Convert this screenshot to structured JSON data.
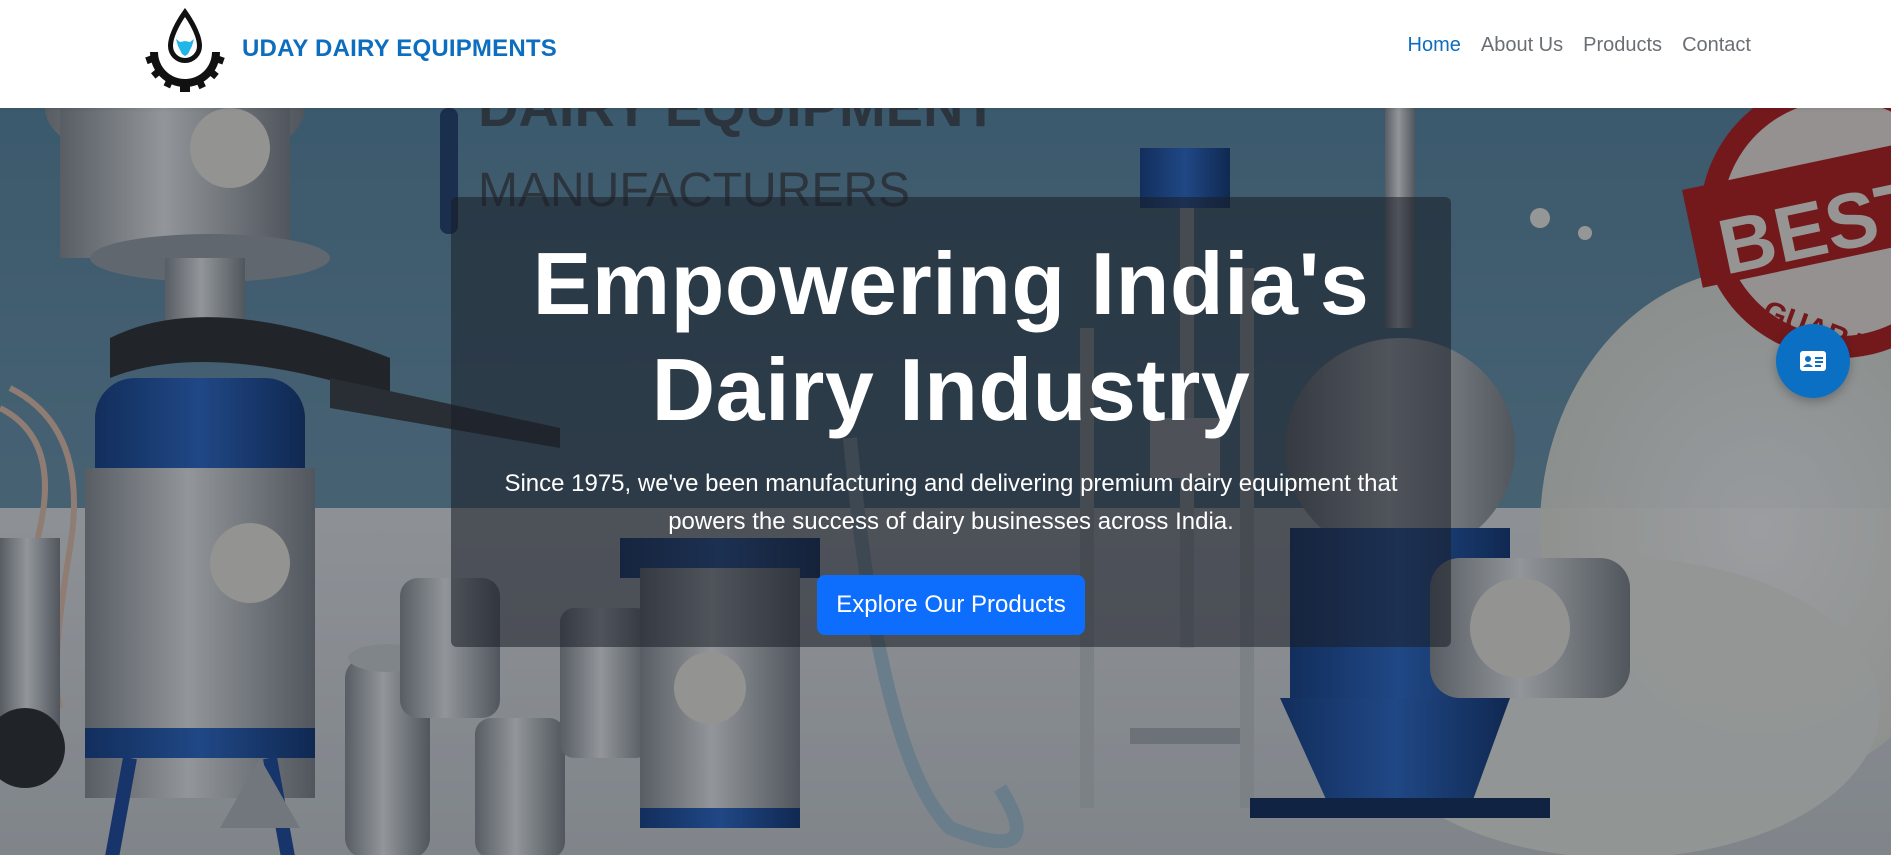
{
  "navbar": {
    "brand_name": "UDAY DAIRY EQUIPMENTS",
    "brand_logo_icon": "milk-drop-gear-logo-icon",
    "links": [
      {
        "label": "Home",
        "active": true
      },
      {
        "label": "About Us",
        "active": false
      },
      {
        "label": "Products",
        "active": false
      },
      {
        "label": "Contact",
        "active": false
      }
    ]
  },
  "hero": {
    "background_text_line1": "DAIRY EQUIPMENT",
    "background_text_line2": "MANUFACTURERS",
    "background_seal_text": "BEST",
    "background_seal_ring_text": "GUARA",
    "title_line1": "Empowering India's",
    "title_line2": "Dairy Industry",
    "subtitle_line1": "Since 1975, we've been manufacturing and delivering premium dairy equipment that",
    "subtitle_line2": "powers the success of dairy businesses across India.",
    "cta_label": "Explore Our Products"
  },
  "floating_button": {
    "icon": "contact-card-icon"
  },
  "colors": {
    "brand": "#0d6ebf",
    "nav_text": "#6b6f74",
    "cta": "#0d6efd",
    "float_button": "#0b6fc4"
  }
}
